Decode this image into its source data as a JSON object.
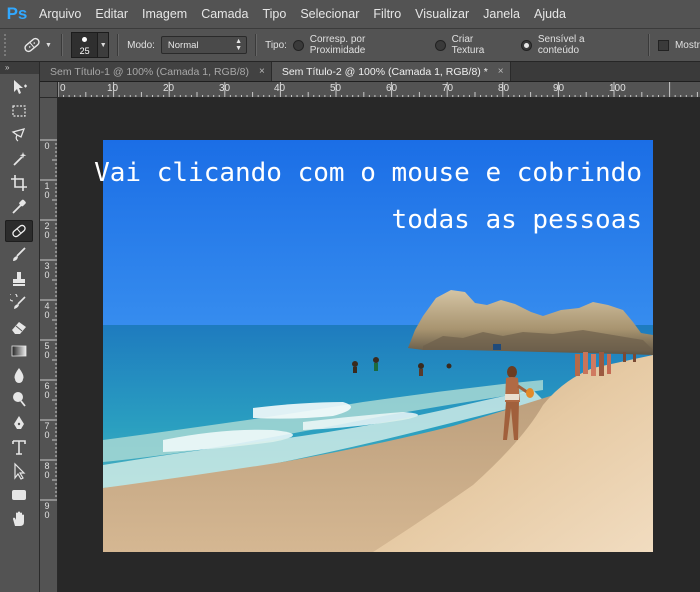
{
  "app": {
    "logo": "Ps"
  },
  "menu": [
    "Arquivo",
    "Editar",
    "Imagem",
    "Camada",
    "Tipo",
    "Selecionar",
    "Filtro",
    "Visualizar",
    "Janela",
    "Ajuda"
  ],
  "options": {
    "brush_size": "25",
    "mode_label": "Modo:",
    "mode_value": "Normal",
    "type_label": "Tipo:",
    "radio_1": "Corresp. por Proximidade",
    "radio_2": "Criar Textura",
    "radio_3": "Sensível a conteúdo",
    "checkbox_label": "Mostr"
  },
  "tabs": [
    {
      "label": "Sem Título-1 @ 100% (Camada 1, RGB/8)",
      "close": "×"
    },
    {
      "label": "Sem Título-2 @ 100% (Camada 1, RGB/8) *",
      "close": "×"
    }
  ],
  "toolbox": {
    "header": "»"
  },
  "ruler_top": [
    "0",
    "10",
    "20",
    "30",
    "40",
    "50",
    "60",
    "70",
    "80",
    "90",
    "100"
  ],
  "ruler_left": [
    "0",
    "1 0",
    "2 0",
    "3 0",
    "4 0",
    "5 0",
    "6 0",
    "7 0",
    "8 0",
    "9 0"
  ],
  "overlay": {
    "line1": "Vai clicando com o mouse e cobrindo",
    "line2": "todas as pessoas"
  },
  "colors": {
    "accent": "#31a8ff",
    "chrome": "#535353",
    "pasteboard": "#282828"
  }
}
